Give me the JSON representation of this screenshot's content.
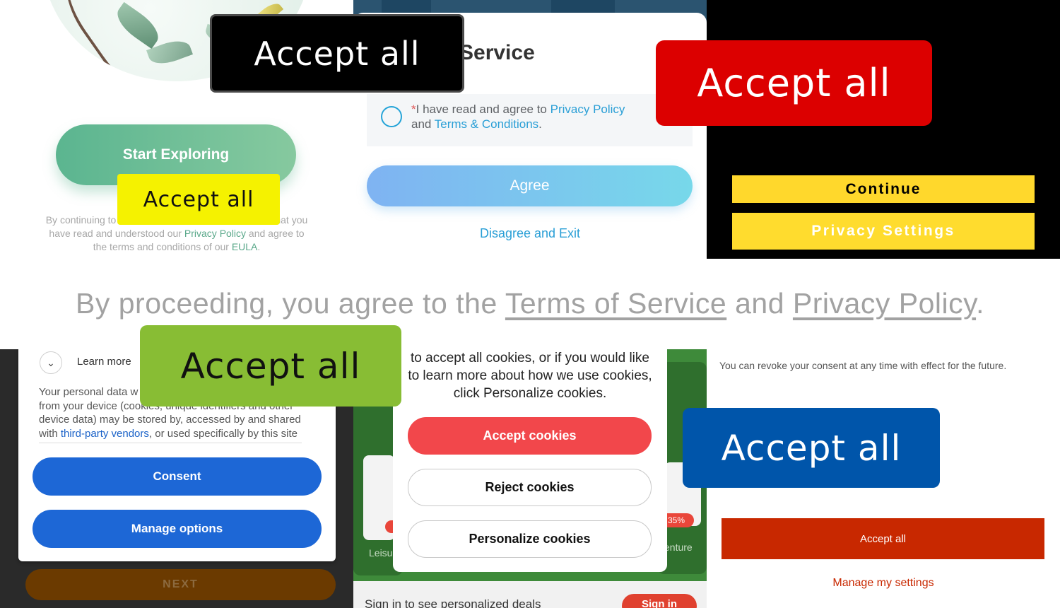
{
  "panel1": {
    "start_button": "Start Exploring",
    "legal_before_1": "By continuing to",
    "legal_hidden_1": " ",
    "legal_after_1": "hat you",
    "legal_line2_a": "have read and understood our ",
    "privacy_policy": "Privacy Policy",
    "legal_line2_b": " and agree to",
    "legal_line3_a": "the terms and conditions of our ",
    "eula": "EULA",
    "legal_line3_b": "."
  },
  "panel2": {
    "title": "Service",
    "required_mark": "*",
    "agree_text_a": "I have read and agree to ",
    "privacy_policy": "Privacy Policy",
    "agree_text_b": "and ",
    "terms": "Terms & Conditions",
    "agree_text_c": ".",
    "agree_button": "Agree",
    "disagree_link": "Disagree and Exit"
  },
  "panel3": {
    "continue_button": "Continue",
    "privacy_settings_button": "Privacy Settings"
  },
  "strip": {
    "text_a": "By proceeding, you agree to the ",
    "terms_link": "Terms of Service",
    "text_b": " and ",
    "privacy_link": "Privacy Policy",
    "text_c": "."
  },
  "panel4": {
    "chevron": "⌄",
    "learn_more": "Learn more",
    "body_line1": "Your personal data w",
    "body_line2": "from your device (cookies, unique identifiers and other",
    "body_line3": "device data) may be stored by, accessed by and shared",
    "body_line4_a": "with ",
    "vendors_link": "third-party vendors",
    "body_line4_b": ", or used specifically by this site",
    "consent_button": "Consent",
    "manage_options_button": "Manage options",
    "next_button": "NEXT"
  },
  "panel5": {
    "dialog_text": "to accept all cookies, or if you would like to learn more about how we use cookies, click Personalize cookies.",
    "accept_cookies": "Accept cookies",
    "reject_cookies": "Reject cookies",
    "personalize_cookies": "Personalize cookies",
    "bg_label_left": "Leisu",
    "bg_label_right": "enture",
    "bg_discount": "35%",
    "sign_in_prompt": "Sign in to see personalized deals",
    "sign_in_button": "Sign in"
  },
  "panel6": {
    "revoke_text": "You can revoke your consent at any time with effect for the future.",
    "accept_all_button": "Accept all",
    "manage_settings_link": "Manage my settings"
  },
  "overlays": {
    "black": "Accept all",
    "red": "Accept all",
    "yellow": "Accept all",
    "green": "Accept all",
    "blue": "Accept all"
  },
  "colors": {
    "overlay_black": "#000000",
    "overlay_red": "#dc0000",
    "overlay_yellow": "#f5f200",
    "overlay_green": "#88bd34",
    "overlay_blue": "#0055aa",
    "consent_blue": "#1d67d6",
    "cookie_red": "#f2474b",
    "accept_dark_red": "#c82800",
    "continue_yellow": "#ffd82c"
  }
}
